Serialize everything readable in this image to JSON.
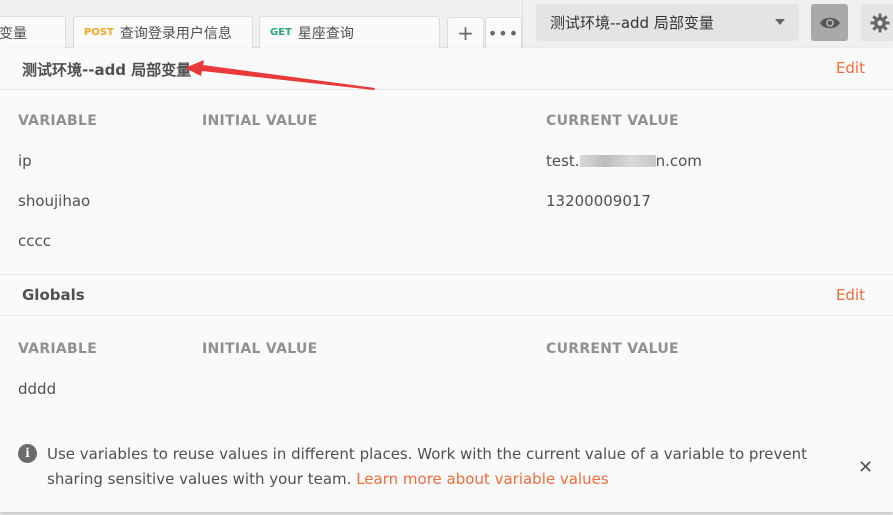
{
  "tabs": [
    {
      "method": "",
      "label": "变量"
    },
    {
      "method": "POST",
      "label": "查询登录用户信息"
    },
    {
      "method": "GET",
      "label": "星座查询"
    }
  ],
  "tab_actions": {
    "add": "+",
    "more": "•••"
  },
  "environment": {
    "selected": "测试环境--add 局部变量"
  },
  "env_section": {
    "title": "测试环境--add 局部变量",
    "edit_label": "Edit",
    "columns": {
      "variable": "VARIABLE",
      "initial": "INITIAL VALUE",
      "current": "CURRENT VALUE"
    },
    "rows": [
      {
        "variable": "ip",
        "initial": "",
        "current_prefix": "test.",
        "current_suffix": "n.com"
      },
      {
        "variable": "shoujihao",
        "initial": "",
        "current": "13200009017"
      },
      {
        "variable": "cccc",
        "initial": "",
        "current": ""
      }
    ]
  },
  "globals_section": {
    "title": "Globals",
    "edit_label": "Edit",
    "columns": {
      "variable": "VARIABLE",
      "initial": "INITIAL VALUE",
      "current": "CURRENT VALUE"
    },
    "rows": [
      {
        "variable": "dddd",
        "initial": "",
        "current": ""
      }
    ]
  },
  "info": {
    "text": "Use variables to reuse values in different places. Work with the current value of a variable to prevent sharing sensitive values with your team.",
    "link": "Learn more about variable values",
    "icon": "info-icon",
    "close": "✕"
  },
  "colors": {
    "accent": "#f26b3a",
    "annotation_arrow": "#e83a3a",
    "post": "#f5a623",
    "get": "#2ea77a"
  }
}
